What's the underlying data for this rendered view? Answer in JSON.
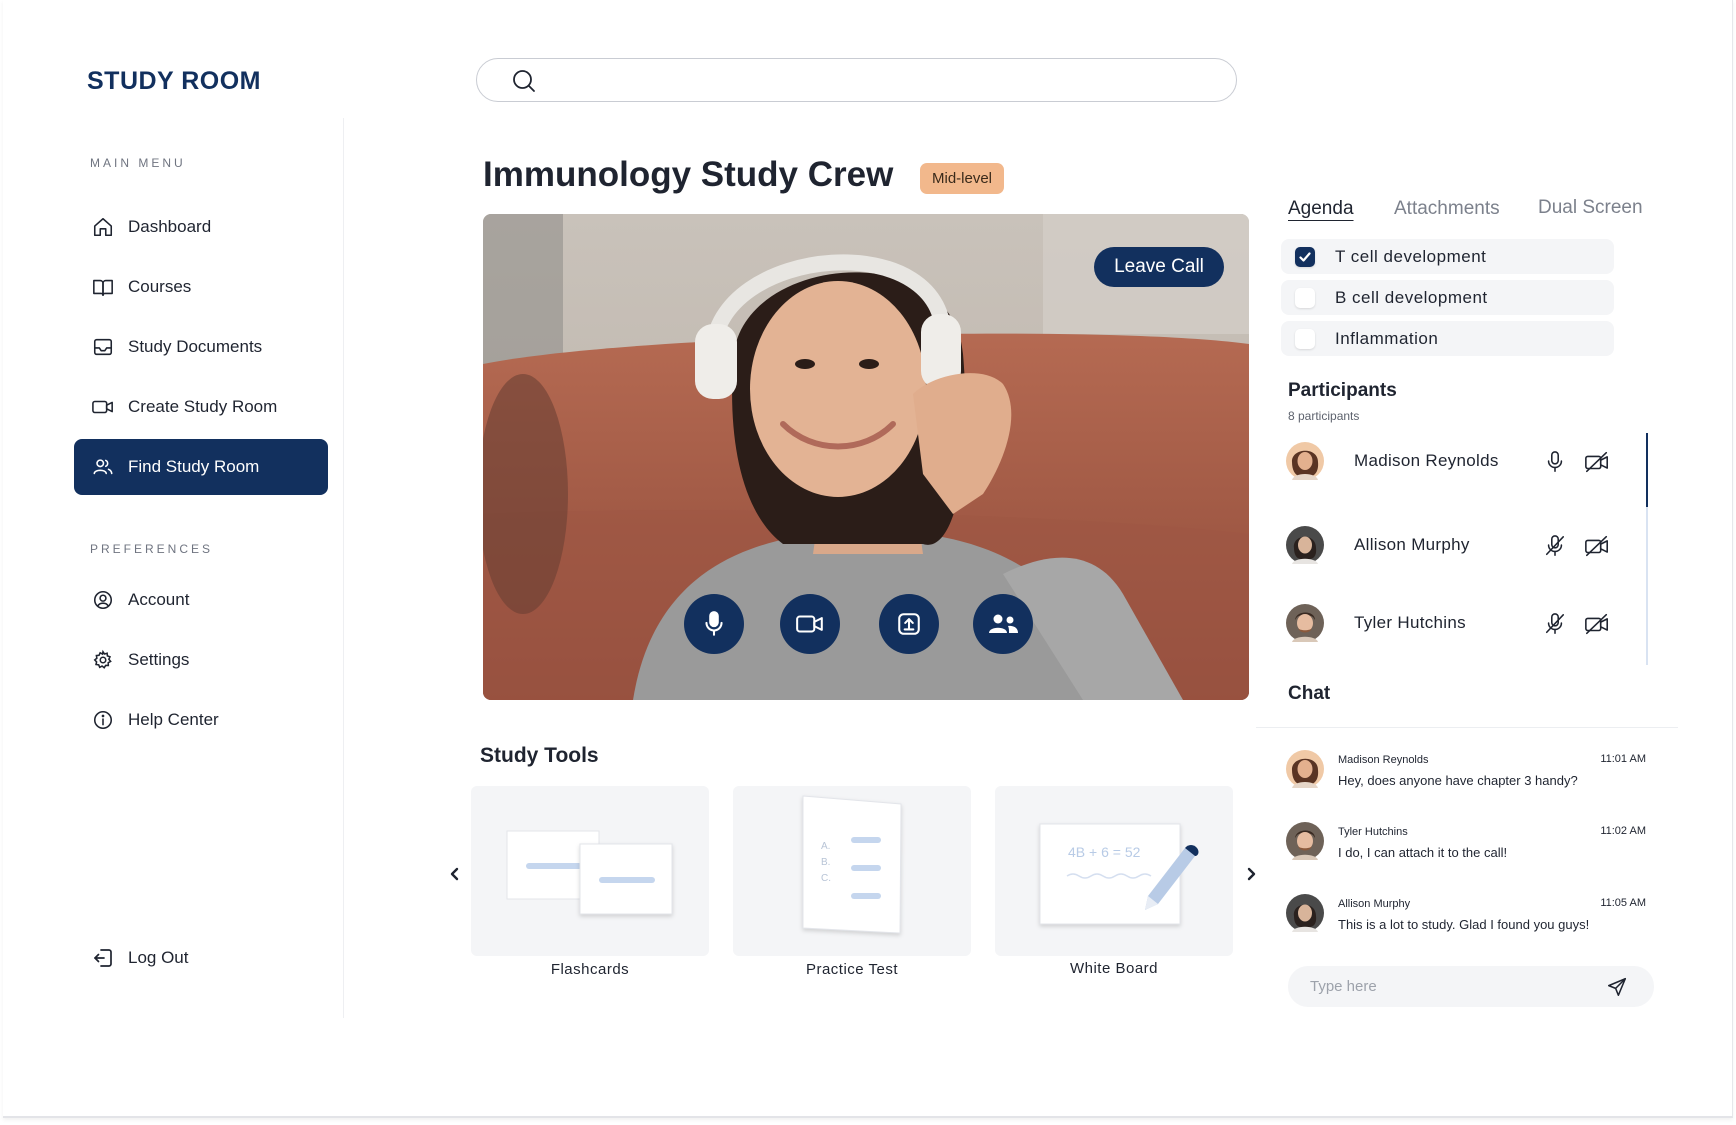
{
  "app": {
    "logo": "STUDY ROOM"
  },
  "sidebar": {
    "main_menu_label": "MAIN MENU",
    "preferences_label": "PREFERENCES",
    "items": [
      {
        "label": "Dashboard",
        "icon": "home-icon"
      },
      {
        "label": "Courses",
        "icon": "book-icon"
      },
      {
        "label": "Study Documents",
        "icon": "inbox-icon"
      },
      {
        "label": "Create Study Room",
        "icon": "video-icon"
      },
      {
        "label": "Find Study Room",
        "icon": "users-icon",
        "active": true
      }
    ],
    "preferences": [
      {
        "label": "Account",
        "icon": "account-icon"
      },
      {
        "label": "Settings",
        "icon": "gear-icon"
      },
      {
        "label": "Help Center",
        "icon": "info-icon"
      }
    ],
    "logout": "Log Out"
  },
  "search": {
    "placeholder": "",
    "value": ""
  },
  "room": {
    "title": "Immunology Study Crew",
    "level": "Mid-level",
    "leave_label": "Leave Call",
    "controls": [
      "microphone-icon",
      "camera-icon",
      "share-screen-icon",
      "participants-icon"
    ]
  },
  "study_tools": {
    "title": "Study Tools",
    "items": [
      {
        "label": "Flashcards"
      },
      {
        "label": "Practice Test",
        "letters": [
          "A.",
          "B.",
          "C."
        ]
      },
      {
        "label": "White Board",
        "equation": "4B + 6 = 52"
      }
    ]
  },
  "right_panel": {
    "tabs": [
      {
        "label": "Agenda",
        "active": true
      },
      {
        "label": "Attachments"
      },
      {
        "label": "Dual Screen"
      }
    ],
    "agenda": [
      {
        "label": "T cell development",
        "checked": true
      },
      {
        "label": "B cell development",
        "checked": false
      },
      {
        "label": "Inflammation",
        "checked": false
      }
    ],
    "participants_title": "Participants",
    "participants_count": "8 participants",
    "participants": [
      {
        "name": "Madison Reynolds",
        "mic": "on",
        "camera": "off"
      },
      {
        "name": "Allison Murphy",
        "mic": "off",
        "camera": "off"
      },
      {
        "name": "Tyler Hutchins",
        "mic": "off",
        "camera": "off"
      }
    ],
    "chat_title": "Chat",
    "messages": [
      {
        "sender": "Madison Reynolds",
        "time": "11:01 AM",
        "text": "Hey, does anyone have chapter 3 handy?"
      },
      {
        "sender": "Tyler Hutchins",
        "time": "11:02 AM",
        "text": "I do, I can attach it to the call!"
      },
      {
        "sender": "Allison Murphy",
        "time": "11:05 AM",
        "text": "This is a lot to study. Glad I found you guys!"
      }
    ],
    "chat_placeholder": "Type here"
  },
  "colors": {
    "brand": "#12305e",
    "badge": "#f2b88c",
    "card": "#f4f5f7"
  }
}
